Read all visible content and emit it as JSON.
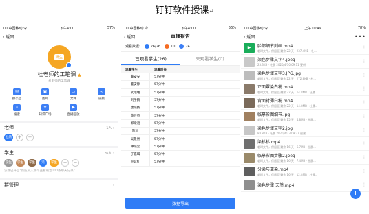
{
  "doc_title": "钉钉软件授课",
  "doc_return_mark": "↵",
  "phone1": {
    "status": {
      "carrier": "ull 中国移动 令",
      "time": "下午4:00",
      "battery": "57%"
    },
    "back_label": "返回",
    "avatar_text": "师生",
    "group_name": "杜老师的工笔课",
    "group_tag": "▲",
    "group_sub": "杜老师的工笔课",
    "features": [
      {
        "label": "群公告",
        "icon": "megaphone-icon",
        "glyph": "✉"
      },
      {
        "label": "图片",
        "icon": "image-icon",
        "glyph": "▣"
      },
      {
        "label": "文件",
        "icon": "folder-icon",
        "glyph": "▭"
      },
      {
        "label": "链接",
        "icon": "link-icon",
        "glyph": "∞"
      },
      {
        "label": "搜索",
        "icon": "search-icon",
        "glyph": "⌕"
      },
      {
        "label": "知识广场",
        "icon": "knowledge-icon",
        "glyph": "✦"
      },
      {
        "label": "直播回放",
        "icon": "playback-icon",
        "glyph": "▶"
      }
    ],
    "teacher_section": {
      "label": "老师",
      "count": "1人 ›",
      "chip": "杜鹃"
    },
    "student_section": {
      "label": "学生",
      "count": "26人 ›",
      "chips": [
        "学生",
        "学生",
        "学生",
        "鸿",
        "学生"
      ]
    },
    "notice": "该群已开启\"新成员入群可查看最近100条聊天记录\"",
    "manage_label": "群管理",
    "manage_arrow": "›",
    "colors": {
      "accent": "#2f7cf6",
      "avatar": "#f5a623"
    }
  },
  "phone2": {
    "status": {
      "carrier": "ull 中国移动 令",
      "time": "下午4:00",
      "battery": "56%"
    },
    "back_label": "返回",
    "title": "直播报告",
    "stats_label": "观看数据:",
    "viewed": "26/26",
    "likes": "10",
    "comments": "24",
    "tabs": [
      "已观看学生(26)",
      "未观看学生(0)"
    ],
    "col_headers": [
      "观看学生",
      "观看时长"
    ],
    "rows": [
      {
        "name": "董安安",
        "duration": "57分钟"
      },
      {
        "name": "董安静",
        "duration": "57分钟"
      },
      {
        "name": "武瑞曦",
        "duration": "57分钟"
      },
      {
        "name": "刘子鹏",
        "duration": "57分钟"
      },
      {
        "name": "唐晓扬",
        "duration": "57分钟"
      },
      {
        "name": "薛佳杰",
        "duration": "57分钟"
      },
      {
        "name": "郭梁涵",
        "duration": "57分钟"
      },
      {
        "name": "陈远",
        "duration": "57分钟"
      },
      {
        "name": "吴景然",
        "duration": "57分钟"
      },
      {
        "name": "钟晓莹",
        "duration": "57分钟"
      },
      {
        "name": "丁嘉琪",
        "duration": "57分钟"
      },
      {
        "name": "赵延红",
        "duration": "57分钟"
      }
    ],
    "export_label": "数据导出"
  },
  "phone3": {
    "status": {
      "carrier": "ull 中国移动 令",
      "time": "上午10:49",
      "battery": "78%"
    },
    "back_label": "返回",
    "more": "•••",
    "files": [
      {
        "name": "脸部细节刻画.mp4",
        "meta": "临时文件，保留至 剩余 22 天 · 237.4MB · 杜...",
        "thumb": "#1aad5a",
        "glyph": "▶"
      },
      {
        "name": "染色步骤文字4.jpeg",
        "meta": "23.3KB · 杜晨 2020/4/30 09:11 更新",
        "thumb": "#c9c9c9",
        "glyph": ""
      },
      {
        "name": "染色步骤文字3.JPG.jpg",
        "meta": "临时文件，保留至 剩余 22 天 · 272.8KB · 杜...",
        "thumb": "#bdbdbd",
        "glyph": ""
      },
      {
        "name": "正面罩染白粉.mp4",
        "meta": "临时文件，保留至 剩余 22 天 · 14.8MB · 杜晨...",
        "thumb": "#8a7a6a",
        "glyph": ""
      },
      {
        "name": "背面衬薄白粉.mp4",
        "meta": "临时文件，保留至 剩余 22 天 · 14.8MB · 杜晨...",
        "thumb": "#7a6a5a",
        "glyph": ""
      },
      {
        "name": "临摹彩图细节.jpg",
        "meta": "临时文件，保留至 剩余 15 天 · 4.8MB · 杜晨...",
        "thumb": "#a08060",
        "glyph": ""
      },
      {
        "name": "染色步骤文字2.jpg",
        "meta": "83.8KB · 杜晨 2020/4/23 09:27 创建",
        "thumb": "#c7c7c7",
        "glyph": ""
      },
      {
        "name": "染衫衫.mp4",
        "meta": "临时文件，保留至 剩余 16 天 · 6.7MB · 杜晨...",
        "thumb": "#6f6f6f",
        "glyph": ""
      },
      {
        "name": "临摹彩图步骤2.jpeg",
        "meta": "临时文件，保留至 剩余 16 天 · 7.4MB · 杜晨...",
        "thumb": "#9a8a6a",
        "glyph": ""
      },
      {
        "name": "分染与罩染.mp4",
        "meta": "临时文件，保留至 剩余 16 天 · 12.8MB · 杜晨...",
        "thumb": "#5f5f5f",
        "glyph": ""
      },
      {
        "name": "染色步骤 天然.mp4",
        "meta": "",
        "thumb": "#8f8f8f",
        "glyph": ""
      }
    ],
    "fab": "+"
  }
}
